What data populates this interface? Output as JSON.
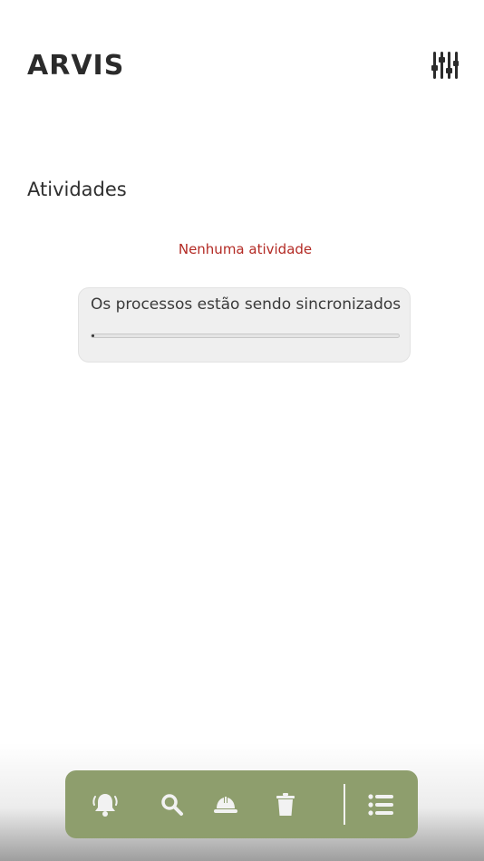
{
  "header": {
    "title": "ARVIS",
    "filter_icon": "sliders-icon"
  },
  "activities": {
    "section_title": "Atividades",
    "empty_message": "Nenhuma atividade"
  },
  "sync": {
    "message": "Os processos estão sendo sincronizados",
    "progress_percent": 1
  },
  "bottom_nav": {
    "items": [
      {
        "icon": "bell-ringing-icon"
      },
      {
        "icon": "search-icon"
      },
      {
        "icon": "hard-hat-icon"
      },
      {
        "icon": "trash-icon"
      },
      {
        "icon": "list-icon"
      }
    ]
  },
  "colors": {
    "nav_bar": "#8e9e6d",
    "nav_icons": "#f2f2f2",
    "empty_message": "#b32a24",
    "card_background": "#efefef"
  }
}
